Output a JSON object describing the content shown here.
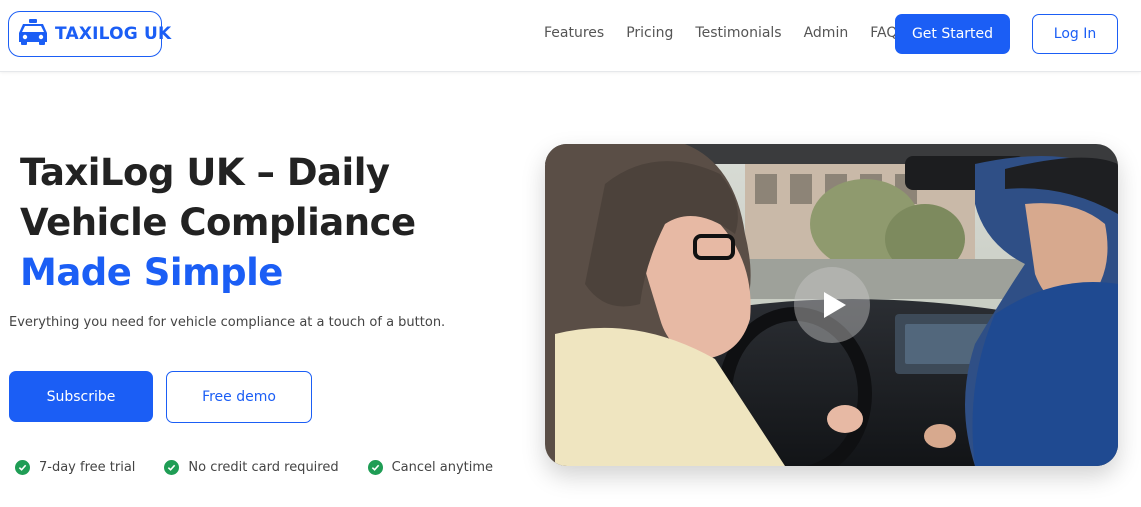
{
  "brand": {
    "name": "TAXILOG UK",
    "icon": "taxi-icon"
  },
  "nav": {
    "links": [
      "Features",
      "Pricing",
      "Testimonials",
      "Admin",
      "FAQ"
    ],
    "get_started": "Get Started",
    "login": "Log In"
  },
  "hero": {
    "title_line1": "TaxiLog UK – Daily",
    "title_line2": "Vehicle Compliance",
    "title_highlight": "Made Simple",
    "subtitle": "Everything you need for vehicle compliance at a touch of a button.",
    "subscribe": "Subscribe",
    "demo": "Free demo",
    "perks": [
      "7-day free trial",
      "No credit card required",
      "Cancel anytime"
    ]
  },
  "video": {
    "play_icon": "play-icon"
  },
  "colors": {
    "accent": "#1b5ef5",
    "check": "#1f9d55"
  }
}
